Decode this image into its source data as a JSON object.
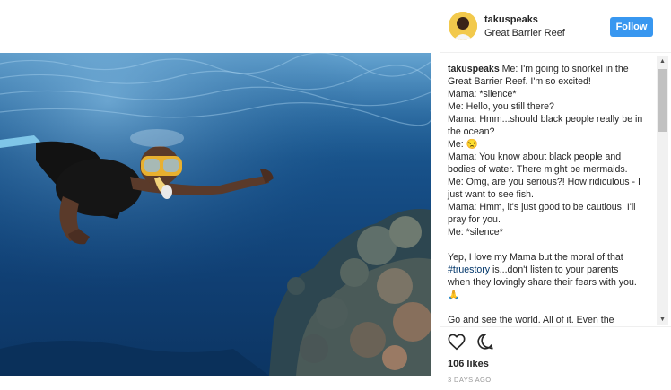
{
  "post": {
    "username": "takuspeaks",
    "location": "Great Barrier Reef",
    "follow_label": "Follow",
    "caption": {
      "username": "takuspeaks",
      "intro": " Me: I'm going to snorkel in the Great Barrier Reef. I'm so excited!",
      "lines": [
        "Mama: *silence*",
        "Me: Hello, you still there?",
        "Mama: Hmm...should black people really be in the ocean?",
        "Me: 😒",
        "Mama: You know about black people and bodies of water. There might be mermaids.",
        "Me: Omg, are you serious?! How ridiculous - I just want to see fish.",
        "Mama: Hmm, it's just good to be cautious. I'll pray for you.",
        "Me: *silence*"
      ],
      "para2_before": "Yep, I love my Mama but the moral of that ",
      "hashtag": "#truestory",
      "para2_after": " is...don't listen to your parents when they lovingly share their fears with you. 🙏",
      "para3": "Go and see the world. All of it. Even the"
    },
    "likes": "106 likes",
    "timestamp": "3 DAYS AGO"
  },
  "icons": {
    "like": "heart-icon",
    "comment": "comment-icon",
    "scroll_up": "arrow-up-icon",
    "scroll_down": "arrow-down-icon"
  },
  "colors": {
    "follow_button": "#3897f0",
    "hashtag": "#003569",
    "timestamp": "#999999",
    "water_top": "#3b7fb3",
    "water_deep": "#0c3563"
  }
}
